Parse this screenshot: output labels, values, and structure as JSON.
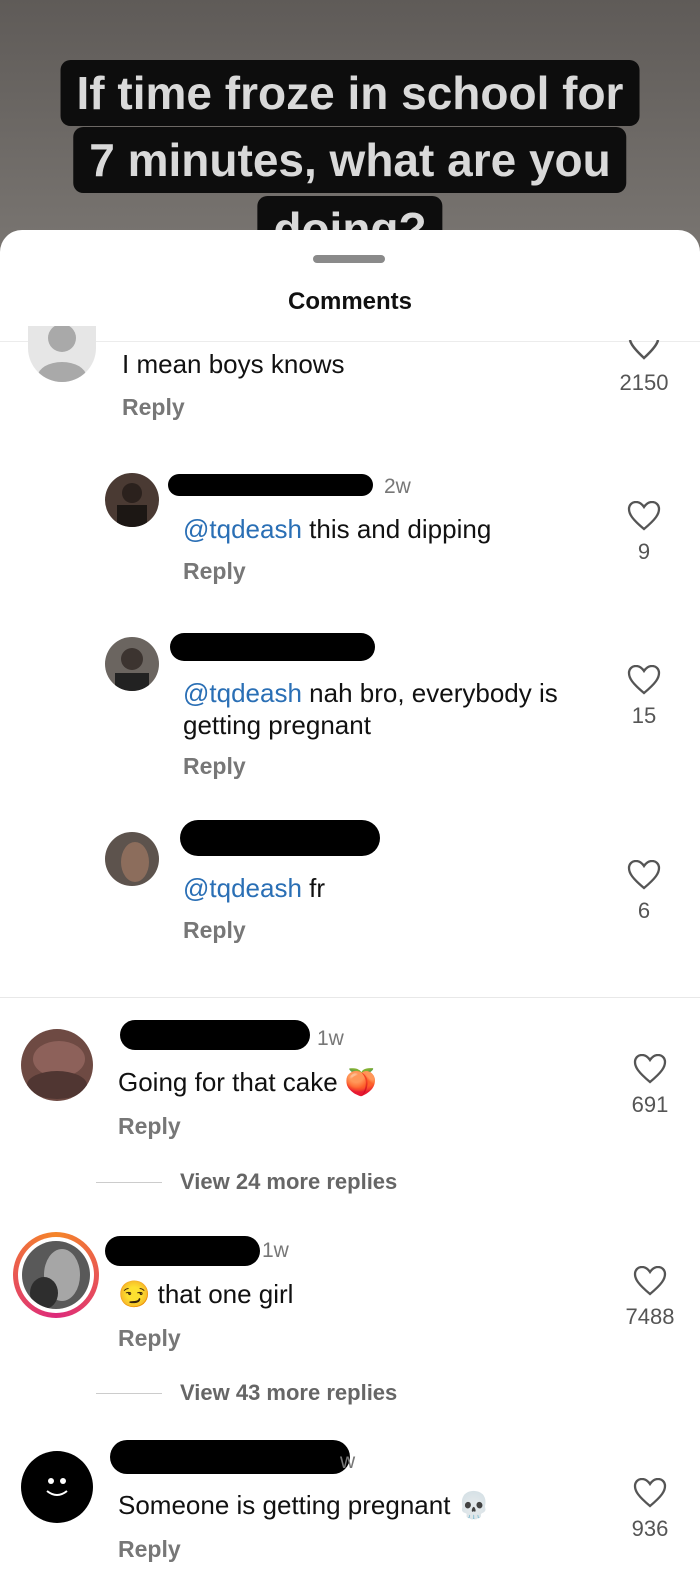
{
  "video": {
    "caption_lines": [
      "If time froze in school for",
      "7 minutes, what are you",
      "doing?"
    ]
  },
  "sheet": {
    "title": "Comments"
  },
  "comments": [
    {
      "id": "c0",
      "text": "I mean boys knows",
      "reply": "Reply",
      "likes": "2150"
    },
    {
      "id": "r1",
      "time": "2w",
      "mention": "@tqdeash",
      "text": " this and dipping",
      "reply": "Reply",
      "likes": "9"
    },
    {
      "id": "r2",
      "mention": "@tqdeash",
      "text": " nah bro, everybody is getting pregnant",
      "reply": "Reply",
      "likes": "15"
    },
    {
      "id": "r3",
      "mention": "@tqdeash",
      "text": " fr",
      "reply": "Reply",
      "likes": "6"
    },
    {
      "id": "c4",
      "time": "1w",
      "text": "Going for that cake 🍑",
      "reply": "Reply",
      "likes": "691",
      "view_more": "View 24 more replies"
    },
    {
      "id": "c5",
      "time": "1w",
      "text": "😏 that one girl",
      "reply": "Reply",
      "likes": "7488",
      "view_more": "View 43 more replies"
    },
    {
      "id": "c6",
      "time": "w",
      "text": "Someone is getting pregnant 💀",
      "reply": "Reply",
      "likes": "936"
    }
  ],
  "icons": {
    "like": "heart-outline-icon"
  },
  "colors": {
    "mention": "#2a6fb5",
    "story_ring_start": "#f58529",
    "story_ring_end": "#dd2a7b"
  }
}
